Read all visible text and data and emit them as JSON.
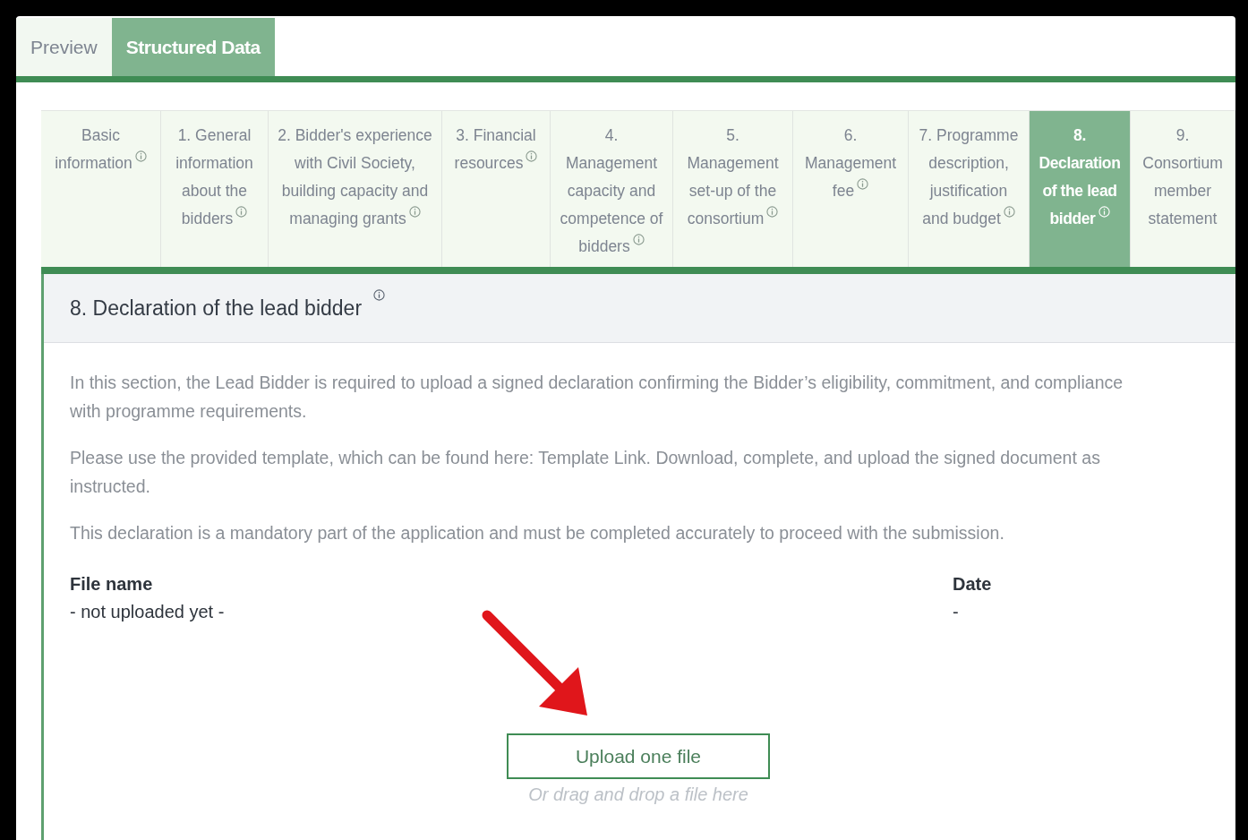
{
  "view_tabs": [
    {
      "label": "Preview",
      "selected": false
    },
    {
      "label": "Structured Data",
      "selected": true
    }
  ],
  "steps": [
    {
      "label": "Basic information",
      "info": true,
      "selected": false
    },
    {
      "label": "1. General information about the bidders",
      "info": true,
      "selected": false
    },
    {
      "label": "2. Bidder's experience with Civil Society, building capacity and managing grants",
      "info": true,
      "selected": false
    },
    {
      "label": "3. Financial resources",
      "info": true,
      "selected": false
    },
    {
      "label": "4. Management capacity and competence of bidders",
      "info": true,
      "selected": false
    },
    {
      "label": "5. Management set-up of the consortium",
      "info": true,
      "selected": false
    },
    {
      "label": "6. Management fee",
      "info": true,
      "selected": false
    },
    {
      "label": "7. Programme description, justification and budget",
      "info": true,
      "selected": false
    },
    {
      "label": "8. Declaration of the lead bidder",
      "info": true,
      "selected": true
    },
    {
      "label": "9. Consortium member statement",
      "info": false,
      "selected": false
    }
  ],
  "section": {
    "title": "8. Declaration of the lead bidder",
    "info": true,
    "paragraphs": [
      "In this section, the Lead Bidder is required to upload a signed declaration confirming the Bidder’s eligibility, commitment, and compliance with programme requirements.",
      "Please use the provided template, which can be found here: Template Link. Download, complete, and upload the signed document as instructed.",
      "This declaration is a mandatory part of the application and must be completed accurately to proceed with the submission."
    ],
    "file_table": {
      "columns": [
        "File name",
        "Date"
      ],
      "row": [
        "- not uploaded yet -",
        "-"
      ]
    },
    "upload_button": "Upload one file",
    "drop_hint": "Or drag and drop a file here"
  }
}
